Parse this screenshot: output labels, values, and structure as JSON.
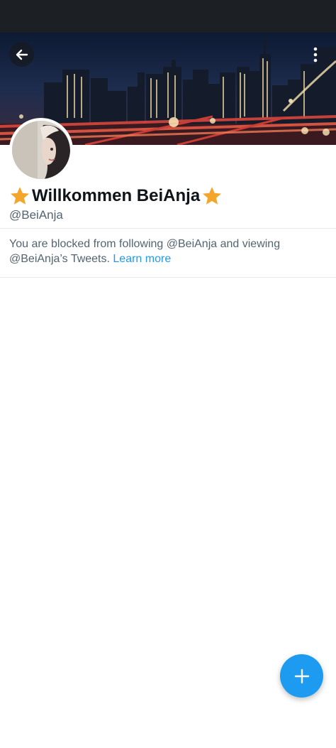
{
  "profile": {
    "display_name": "Willkommen BeiAnja",
    "handle": "@BeiAnja",
    "name_decoration_icon": "star-icon"
  },
  "notice": {
    "text": "You are blocked from following @BeiAnja and viewing @BeiAnja’s Tweets.",
    "link_label": "Learn more"
  },
  "icons": {
    "back": "arrow-left-icon",
    "more": "more-vertical-icon",
    "compose": "plus-icon"
  },
  "colors": {
    "accent": "#1d9bf0",
    "star": "#f4a52b",
    "text_primary": "#0f1419",
    "text_secondary": "#536471",
    "status_bar": "#1c2024"
  }
}
